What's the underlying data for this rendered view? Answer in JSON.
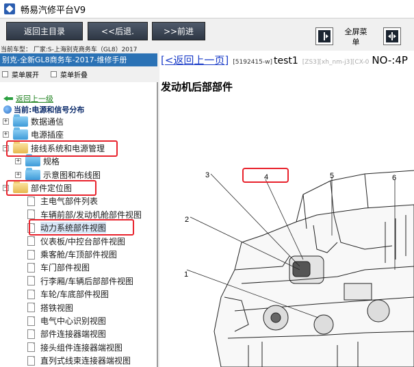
{
  "app": {
    "title": "畅易汽修平台V9"
  },
  "toolbar": {
    "home_label": "返回主目录",
    "back_label": "<<后退.",
    "forward_label": ">>前进",
    "fullscreen_label": "全屏菜单"
  },
  "vehicle_line": "当前车型： 厂家:S-上海别克商务车（GL8）2017",
  "left": {
    "header": "别克-全新GL8商务车-2017-维修手册",
    "expand_label": "菜单展开",
    "collapse_label": "菜单折叠",
    "back_link": "返回上一级",
    "current": "当前:电源和信号分布",
    "tree": [
      {
        "label": "数据通信",
        "type": "folder",
        "expander": "+"
      },
      {
        "label": "电源插座",
        "type": "folder",
        "expander": "+"
      },
      {
        "label": "接线系统和电源管理",
        "type": "folder-open",
        "expander": "−"
      },
      {
        "label": "规格",
        "type": "folder",
        "expander": "+"
      },
      {
        "label": "示意图和布线图",
        "type": "folder",
        "expander": "+"
      },
      {
        "label": "部件定位图",
        "type": "folder-open",
        "expander": "−"
      },
      {
        "label": "主电气部件列表",
        "type": "doc"
      },
      {
        "label": "车辆前部/发动机舱部件视图",
        "type": "doc"
      },
      {
        "label": "动力系统部件视图",
        "type": "doc"
      },
      {
        "label": "仪表板/中控台部件视图",
        "type": "doc"
      },
      {
        "label": "乘客舱/车顶部件视图",
        "type": "doc"
      },
      {
        "label": "车门部件视图",
        "type": "doc"
      },
      {
        "label": "行李厢/车辆后部部件视图",
        "type": "doc"
      },
      {
        "label": "车轮/车底部件视图",
        "type": "doc"
      },
      {
        "label": "搭铁视图",
        "type": "doc"
      },
      {
        "label": "电气中心识别视图",
        "type": "doc"
      },
      {
        "label": "部件连接器端视图",
        "type": "doc"
      },
      {
        "label": "接头组件连接器端视图",
        "type": "doc"
      },
      {
        "label": "直列式线束连接器端视图",
        "type": "doc"
      }
    ]
  },
  "right": {
    "back_link": "[<返回上一页]",
    "code1": "[5192415-w]",
    "doc_name": "test1",
    "code2": "[ZS3][xh_nm-j3][CX-0",
    "doc_no": "NO-:4P",
    "heading": "发动机后部部件",
    "callouts": [
      "1",
      "2",
      "3",
      "4",
      "5",
      "6"
    ]
  },
  "colors": {
    "left_header_bg": "#2b72b5",
    "highlight_border": "#e8222c",
    "link_blue": "#1a3cc8",
    "link_green": "#1a7f1a"
  }
}
